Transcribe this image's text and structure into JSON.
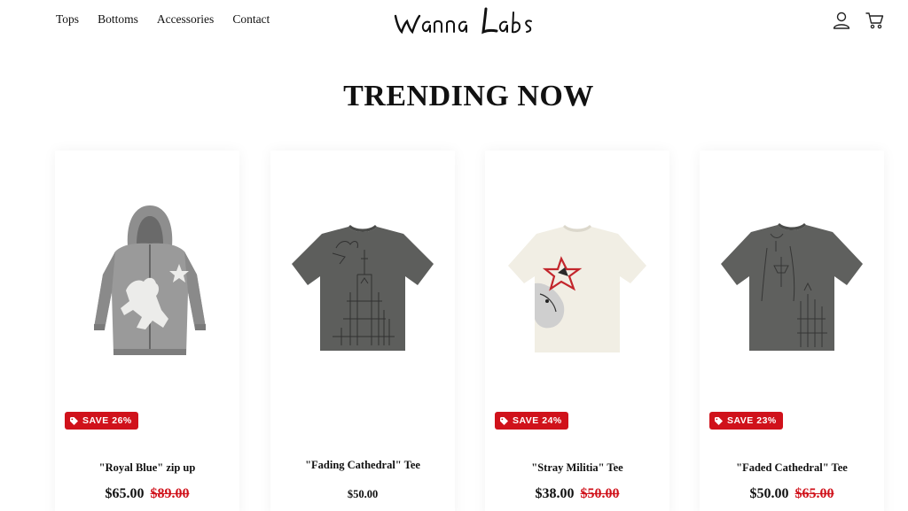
{
  "nav": {
    "items": [
      {
        "label": "Tops"
      },
      {
        "label": "Bottoms"
      },
      {
        "label": "Accessories"
      },
      {
        "label": "Contact"
      }
    ]
  },
  "logo": {
    "text": "Wanna Labs"
  },
  "header_icons": [
    "account-icon",
    "cart-icon"
  ],
  "title": "TRENDING NOW",
  "colors": {
    "sale": "#d0121b",
    "text": "#111111",
    "background": "#ffffff"
  },
  "products": [
    {
      "name": "\"Royal Blue\" zip up",
      "badge": "SAVE 26%",
      "price": "$65.00",
      "compare_price": "$89.00"
    },
    {
      "name": "\"Fading Cathedral\" Tee",
      "badge": "",
      "price": "$50.00",
      "compare_price": ""
    },
    {
      "name": "\"Stray Militia\" Tee",
      "badge": "SAVE 24%",
      "price": "$38.00",
      "compare_price": "$50.00"
    },
    {
      "name": "\"Faded Cathedral\" Tee",
      "badge": "SAVE 23%",
      "price": "$50.00",
      "compare_price": "$65.00"
    }
  ]
}
